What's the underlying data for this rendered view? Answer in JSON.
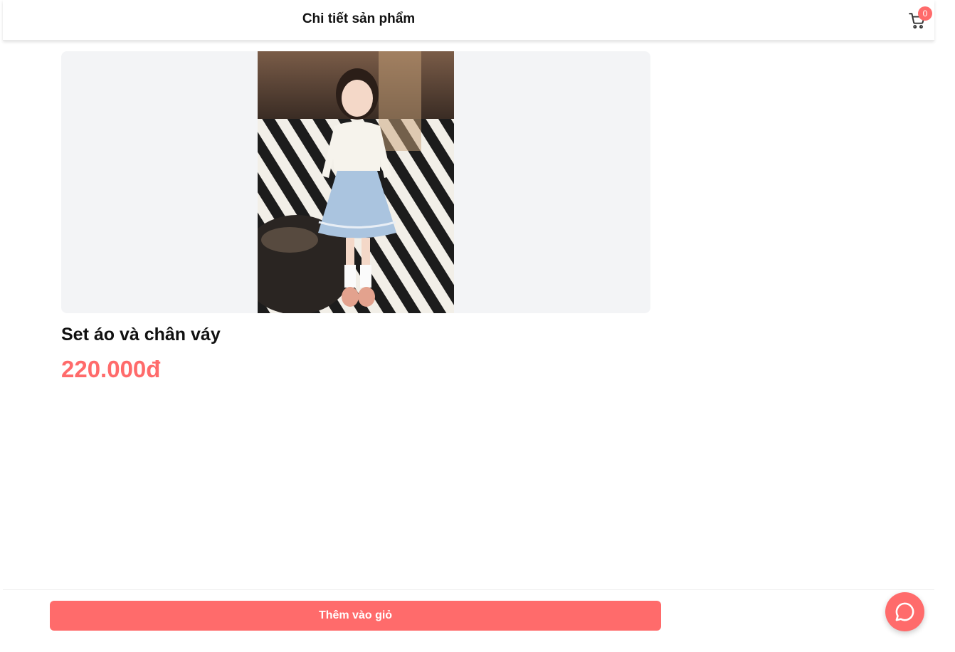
{
  "header": {
    "title": "Chi tiết sản phẩm",
    "cart_count": "0",
    "cart_icon": "shopping-cart-icon"
  },
  "product": {
    "name": "Set áo và chân váy",
    "price": "220.000đ"
  },
  "footer": {
    "add_to_cart_label": "Thêm vào giỏ",
    "chat_icon": "chat-bubble-icon"
  },
  "colors": {
    "accent": "#ff6b6b",
    "gallery_bg": "#f3f4f6",
    "text": "#111111"
  }
}
